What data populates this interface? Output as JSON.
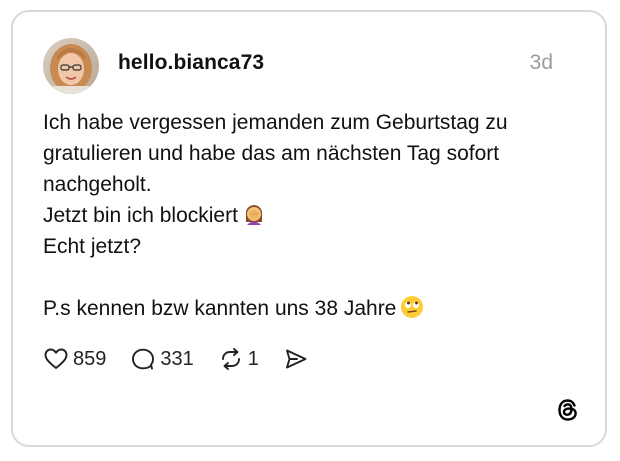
{
  "post": {
    "username": "hello.bianca73",
    "time": "3d",
    "lines": [
      "Ich habe vergessen jemanden zum Geburtstag zu",
      "gratulieren und habe das am nächsten Tag sofort",
      "nachgeholt.",
      "Jetzt bin ich blockiert",
      "Echt jetzt?",
      "",
      "P.s kennen bzw kannten uns 38 Jahre"
    ],
    "emojis": {
      "line4": "facepalm-woman-emoji",
      "line7": "eye-roll-emoji"
    }
  },
  "actions": {
    "likes": "859",
    "comments": "331",
    "reposts": "1",
    "like_icon": "heart-icon",
    "comment_icon": "comment-bubble-icon",
    "repost_icon": "repost-icon",
    "share_icon": "send-icon"
  },
  "brand": {
    "logo": "threads-logo-icon"
  },
  "colors": {
    "border": "#d9d9d9",
    "text": "#111111",
    "muted": "#9a9a9a"
  }
}
